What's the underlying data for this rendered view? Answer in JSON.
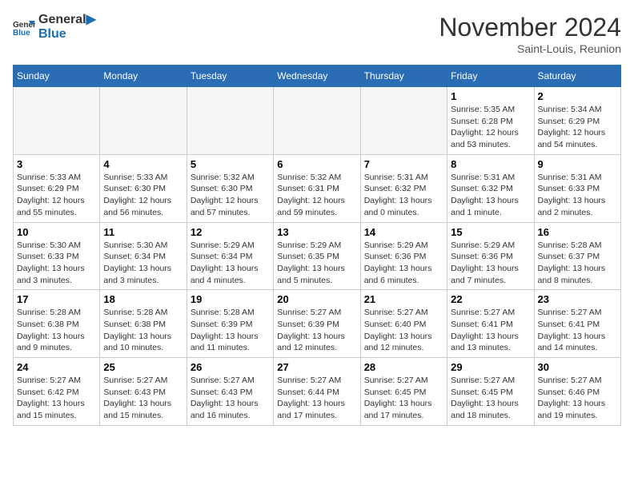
{
  "logo": {
    "general": "General",
    "blue": "Blue"
  },
  "title": "November 2024",
  "subtitle": "Saint-Louis, Reunion",
  "days_of_week": [
    "Sunday",
    "Monday",
    "Tuesday",
    "Wednesday",
    "Thursday",
    "Friday",
    "Saturday"
  ],
  "weeks": [
    [
      {
        "day": "",
        "info": ""
      },
      {
        "day": "",
        "info": ""
      },
      {
        "day": "",
        "info": ""
      },
      {
        "day": "",
        "info": ""
      },
      {
        "day": "",
        "info": ""
      },
      {
        "day": "1",
        "info": "Sunrise: 5:35 AM\nSunset: 6:28 PM\nDaylight: 12 hours and 53 minutes."
      },
      {
        "day": "2",
        "info": "Sunrise: 5:34 AM\nSunset: 6:29 PM\nDaylight: 12 hours and 54 minutes."
      }
    ],
    [
      {
        "day": "3",
        "info": "Sunrise: 5:33 AM\nSunset: 6:29 PM\nDaylight: 12 hours and 55 minutes."
      },
      {
        "day": "4",
        "info": "Sunrise: 5:33 AM\nSunset: 6:30 PM\nDaylight: 12 hours and 56 minutes."
      },
      {
        "day": "5",
        "info": "Sunrise: 5:32 AM\nSunset: 6:30 PM\nDaylight: 12 hours and 57 minutes."
      },
      {
        "day": "6",
        "info": "Sunrise: 5:32 AM\nSunset: 6:31 PM\nDaylight: 12 hours and 59 minutes."
      },
      {
        "day": "7",
        "info": "Sunrise: 5:31 AM\nSunset: 6:32 PM\nDaylight: 13 hours and 0 minutes."
      },
      {
        "day": "8",
        "info": "Sunrise: 5:31 AM\nSunset: 6:32 PM\nDaylight: 13 hours and 1 minute."
      },
      {
        "day": "9",
        "info": "Sunrise: 5:31 AM\nSunset: 6:33 PM\nDaylight: 13 hours and 2 minutes."
      }
    ],
    [
      {
        "day": "10",
        "info": "Sunrise: 5:30 AM\nSunset: 6:33 PM\nDaylight: 13 hours and 3 minutes."
      },
      {
        "day": "11",
        "info": "Sunrise: 5:30 AM\nSunset: 6:34 PM\nDaylight: 13 hours and 3 minutes."
      },
      {
        "day": "12",
        "info": "Sunrise: 5:29 AM\nSunset: 6:34 PM\nDaylight: 13 hours and 4 minutes."
      },
      {
        "day": "13",
        "info": "Sunrise: 5:29 AM\nSunset: 6:35 PM\nDaylight: 13 hours and 5 minutes."
      },
      {
        "day": "14",
        "info": "Sunrise: 5:29 AM\nSunset: 6:36 PM\nDaylight: 13 hours and 6 minutes."
      },
      {
        "day": "15",
        "info": "Sunrise: 5:29 AM\nSunset: 6:36 PM\nDaylight: 13 hours and 7 minutes."
      },
      {
        "day": "16",
        "info": "Sunrise: 5:28 AM\nSunset: 6:37 PM\nDaylight: 13 hours and 8 minutes."
      }
    ],
    [
      {
        "day": "17",
        "info": "Sunrise: 5:28 AM\nSunset: 6:38 PM\nDaylight: 13 hours and 9 minutes."
      },
      {
        "day": "18",
        "info": "Sunrise: 5:28 AM\nSunset: 6:38 PM\nDaylight: 13 hours and 10 minutes."
      },
      {
        "day": "19",
        "info": "Sunrise: 5:28 AM\nSunset: 6:39 PM\nDaylight: 13 hours and 11 minutes."
      },
      {
        "day": "20",
        "info": "Sunrise: 5:27 AM\nSunset: 6:39 PM\nDaylight: 13 hours and 12 minutes."
      },
      {
        "day": "21",
        "info": "Sunrise: 5:27 AM\nSunset: 6:40 PM\nDaylight: 13 hours and 12 minutes."
      },
      {
        "day": "22",
        "info": "Sunrise: 5:27 AM\nSunset: 6:41 PM\nDaylight: 13 hours and 13 minutes."
      },
      {
        "day": "23",
        "info": "Sunrise: 5:27 AM\nSunset: 6:41 PM\nDaylight: 13 hours and 14 minutes."
      }
    ],
    [
      {
        "day": "24",
        "info": "Sunrise: 5:27 AM\nSunset: 6:42 PM\nDaylight: 13 hours and 15 minutes."
      },
      {
        "day": "25",
        "info": "Sunrise: 5:27 AM\nSunset: 6:43 PM\nDaylight: 13 hours and 15 minutes."
      },
      {
        "day": "26",
        "info": "Sunrise: 5:27 AM\nSunset: 6:43 PM\nDaylight: 13 hours and 16 minutes."
      },
      {
        "day": "27",
        "info": "Sunrise: 5:27 AM\nSunset: 6:44 PM\nDaylight: 13 hours and 17 minutes."
      },
      {
        "day": "28",
        "info": "Sunrise: 5:27 AM\nSunset: 6:45 PM\nDaylight: 13 hours and 17 minutes."
      },
      {
        "day": "29",
        "info": "Sunrise: 5:27 AM\nSunset: 6:45 PM\nDaylight: 13 hours and 18 minutes."
      },
      {
        "day": "30",
        "info": "Sunrise: 5:27 AM\nSunset: 6:46 PM\nDaylight: 13 hours and 19 minutes."
      }
    ]
  ]
}
